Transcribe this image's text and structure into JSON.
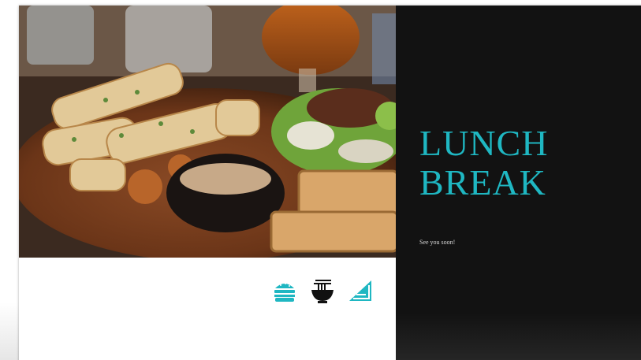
{
  "slide": {
    "title": "LUNCH\nBREAK",
    "subtitle": "See you soon!"
  },
  "photo": {
    "description_icon": "food-photo"
  },
  "icons": [
    {
      "name": "burger-icon",
      "color": "#1fb7c2"
    },
    {
      "name": "noodle-bowl-icon",
      "color": "#111111"
    },
    {
      "name": "sandwich-icon",
      "color": "#1fb7c2"
    }
  ],
  "colors": {
    "accent": "#1fb7c2",
    "panel": "#121212",
    "background": "#ffffff"
  }
}
